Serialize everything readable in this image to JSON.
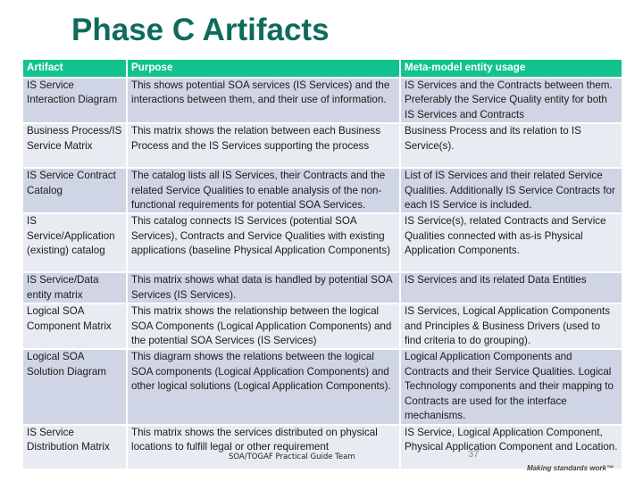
{
  "title": "Phase C Artifacts",
  "table": {
    "headers": [
      "Artifact",
      "Purpose",
      "Meta-model entity usage"
    ],
    "rows": [
      {
        "artifact": "IS Service Interaction Diagram",
        "purpose": "This shows  potential SOA services (IS Services) and the interactions between them, and their use of information.",
        "usage": "IS Services and the Contracts between them. Preferably the Service Quality entity for both IS Services and Contracts"
      },
      {
        "artifact": "Business Process/IS Service Matrix",
        "purpose": "This matrix shows the relation between each Business Process and the IS Services supporting the process",
        "usage": "Business Process and its relation to IS Service(s)."
      },
      {
        "artifact": "IS Service Contract Catalog",
        "purpose": "The catalog lists all IS Services, their Contracts and the related Service Qualities to enable analysis of the non-functional requirements for potential SOA Services.",
        "usage": "List of IS Services and their related Service Qualities. Additionally IS Service Contracts for each IS Service is included."
      },
      {
        "artifact": "IS Service/Application (existing) catalog",
        "purpose": "This catalog connects IS Services (potential SOA Services), Contracts and Service Qualities with existing applications (baseline Physical Application Components)",
        "usage": "IS Service(s), related Contracts and Service Qualities connected with as-is Physical Application Components."
      },
      {
        "artifact": "IS Service/Data entity matrix",
        "purpose": "This matrix shows what data is handled by potential SOA Services (IS Services).",
        "usage": "IS Services and its related Data Entities"
      },
      {
        "artifact": "Logical SOA Component Matrix",
        "purpose": "This matrix shows the relationship between the logical SOA Components (Logical Application Components) and the potential SOA Services (IS Services)",
        "usage": "IS Services, Logical Application Components and Principles & Business Drivers (used to find criteria to do grouping)."
      },
      {
        "artifact": "Logical SOA Solution Diagram",
        "purpose": "This diagram shows the relations between the logical SOA components (Logical Application Components) and other logical solutions (Logical Application Components).",
        "usage": "Logical Application Components and Contracts and their Service Qualities. Logical Technology components and their mapping to Contracts are used for the interface mechanisms."
      },
      {
        "artifact": "IS Service Distribution Matrix",
        "purpose": "This matrix shows the services distributed on physical locations to fulfill legal or other requirement",
        "usage": "IS Service, Logical Application Component, Physical Application Component and Location."
      }
    ]
  },
  "footer": {
    "team": "SOA/TOGAF Practical Guide Team",
    "page_number": "37",
    "tagline": "Making standards work™"
  },
  "colors": {
    "title": "#0e6b5c",
    "header_bg": "#12c28f",
    "row_dark": "#cfd5e4",
    "row_light": "#e8ebf2"
  }
}
